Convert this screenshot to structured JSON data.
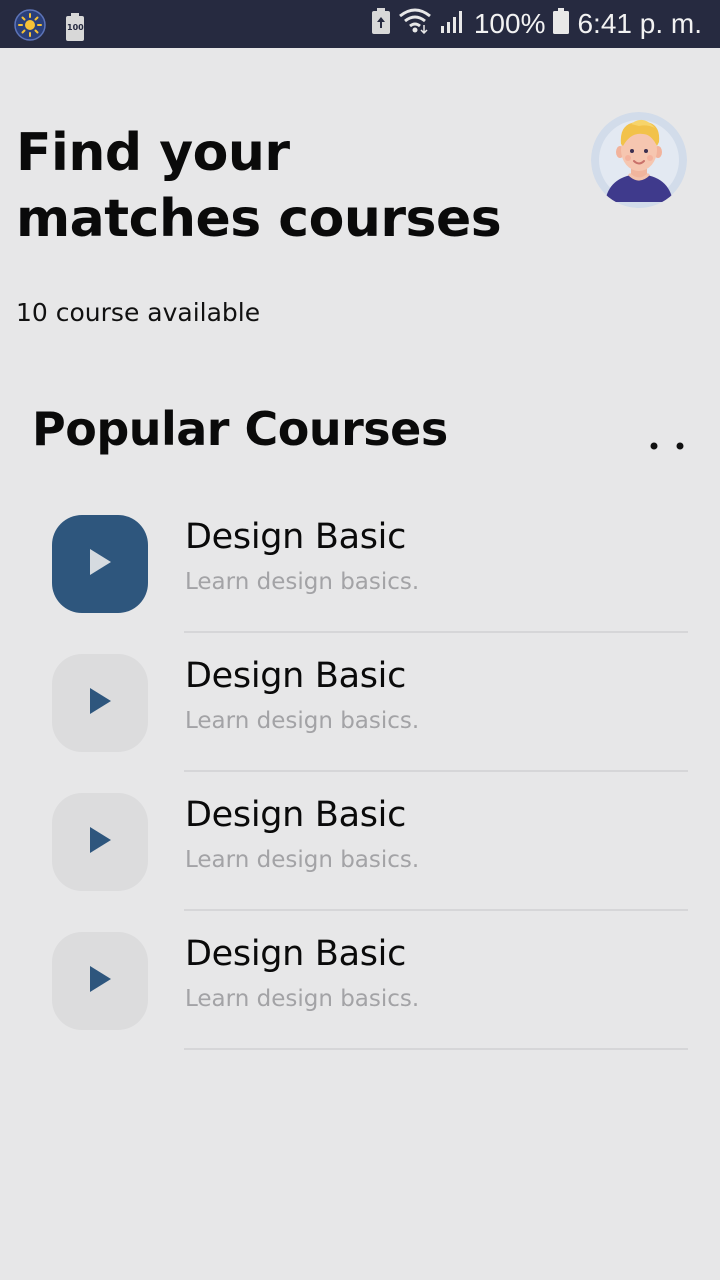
{
  "status_bar": {
    "battery_badge": "100",
    "battery_percent": "100%",
    "time": "6:41 p. m."
  },
  "header": {
    "title_line1": "Find your",
    "title_line2": "matches courses",
    "subtitle": "10 course available"
  },
  "section": {
    "title": "Popular Courses"
  },
  "courses": [
    {
      "title": "Design Basic",
      "description": "Learn design basics.",
      "active": true
    },
    {
      "title": "Design Basic",
      "description": "Learn design basics.",
      "active": false
    },
    {
      "title": "Design Basic",
      "description": "Learn design basics.",
      "active": false
    },
    {
      "title": "Design Basic",
      "description": "Learn design basics.",
      "active": false
    }
  ],
  "colors": {
    "status_bar_bg": "#262a40",
    "background": "#e7e7e8",
    "accent": "#2e567d",
    "thumb_bg": "#dcdcdd",
    "description": "#a3a3a6"
  }
}
